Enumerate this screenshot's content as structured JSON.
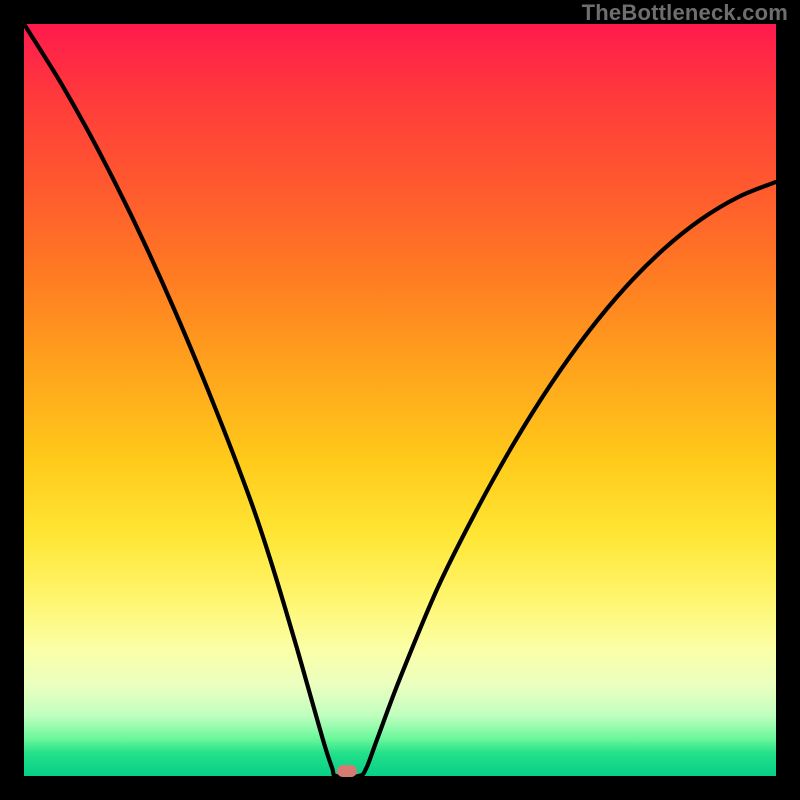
{
  "watermark": "TheBottleneck.com",
  "chart_data": {
    "type": "line",
    "title": "",
    "xlabel": "",
    "ylabel": "",
    "xlim_fraction": [
      0,
      1
    ],
    "ylim_fraction": [
      0,
      1
    ],
    "minimum_x_fraction": 0.43,
    "minimum_y_fraction": 0.0,
    "series": [
      {
        "name": "bottleneck-curve",
        "description": "V-shaped curve; y=0 is bottom, y=1 is top. x is fraction across width.",
        "points": [
          {
            "x": 0.0,
            "y": 1.0
          },
          {
            "x": 0.05,
            "y": 0.92
          },
          {
            "x": 0.1,
            "y": 0.83
          },
          {
            "x": 0.15,
            "y": 0.73
          },
          {
            "x": 0.2,
            "y": 0.62
          },
          {
            "x": 0.25,
            "y": 0.5
          },
          {
            "x": 0.3,
            "y": 0.37
          },
          {
            "x": 0.33,
            "y": 0.28
          },
          {
            "x": 0.36,
            "y": 0.18
          },
          {
            "x": 0.38,
            "y": 0.11
          },
          {
            "x": 0.4,
            "y": 0.04
          },
          {
            "x": 0.41,
            "y": 0.01
          },
          {
            "x": 0.415,
            "y": 0.0
          },
          {
            "x": 0.445,
            "y": 0.0
          },
          {
            "x": 0.455,
            "y": 0.01
          },
          {
            "x": 0.47,
            "y": 0.05
          },
          {
            "x": 0.5,
            "y": 0.13
          },
          {
            "x": 0.55,
            "y": 0.25
          },
          {
            "x": 0.6,
            "y": 0.35
          },
          {
            "x": 0.65,
            "y": 0.44
          },
          {
            "x": 0.7,
            "y": 0.52
          },
          {
            "x": 0.75,
            "y": 0.59
          },
          {
            "x": 0.8,
            "y": 0.65
          },
          {
            "x": 0.85,
            "y": 0.7
          },
          {
            "x": 0.9,
            "y": 0.74
          },
          {
            "x": 0.95,
            "y": 0.77
          },
          {
            "x": 1.0,
            "y": 0.79
          }
        ]
      }
    ],
    "gradient_stops": [
      {
        "pos": 0.0,
        "color": "#ff1a4d"
      },
      {
        "pos": 0.5,
        "color": "#ffca1a"
      },
      {
        "pos": 0.8,
        "color": "#fbffa6"
      },
      {
        "pos": 1.0,
        "color": "#07cf86"
      }
    ],
    "marker": {
      "shape": "rounded-rect",
      "color": "#d77a72",
      "x_fraction": 0.43,
      "y_fraction": 0.0
    }
  }
}
